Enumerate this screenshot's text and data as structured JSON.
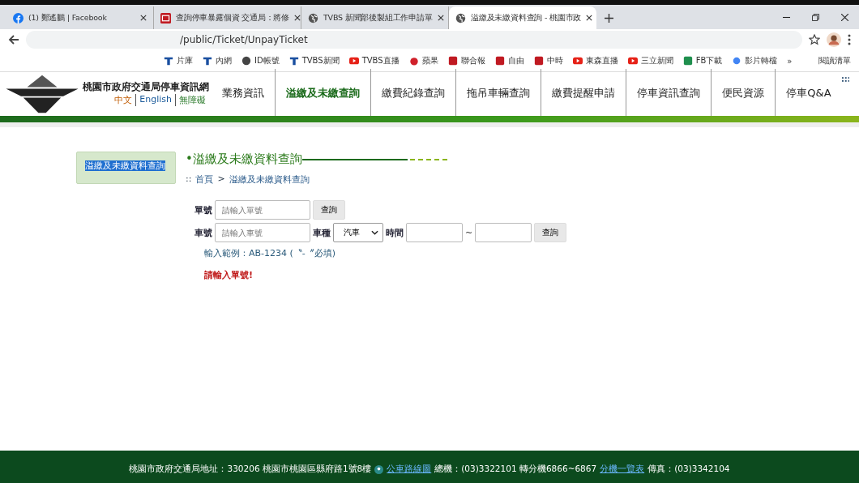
{
  "tabs": [
    {
      "kind": "facebook",
      "title": "(1) 鄭遙鵬 | Facebook",
      "selected": false
    },
    {
      "kind": "news",
      "title": "查詢停車暴露個資 交通局：將修",
      "selected": false
    },
    {
      "kind": "web",
      "title": "TVBS 新聞部後製組工作申請單",
      "selected": false
    },
    {
      "kind": "web",
      "title": "溢繳及未繳資料查詢 - 桃園市政",
      "selected": true
    }
  ],
  "address_bar": {
    "url": "/public/Ticket/UnpayTicket"
  },
  "bookmarks": [
    {
      "kind": "tee",
      "label": "片庫"
    },
    {
      "kind": "tee",
      "label": "內網"
    },
    {
      "kind": "web",
      "label": "ID帳號"
    },
    {
      "kind": "tee",
      "label": "TVBS新聞"
    },
    {
      "kind": "video",
      "label": "TVBS直播"
    },
    {
      "kind": "fruit",
      "label": "蘋果"
    },
    {
      "kind": "square",
      "label": "聯合報"
    },
    {
      "kind": "square",
      "label": "自由"
    },
    {
      "kind": "square",
      "label": "中時"
    },
    {
      "kind": "video",
      "label": "東森直播"
    },
    {
      "kind": "video",
      "label": "三立新聞"
    },
    {
      "kind": "green",
      "label": "FB下載"
    },
    {
      "kind": "dots",
      "label": "影片轉檔"
    }
  ],
  "bookmarks_more": "»",
  "reading_list": "閱讀清單",
  "site": {
    "name": "桃園市政府交通局停車資訊網",
    "languages": [
      "中文",
      "English",
      "無障礙"
    ]
  },
  "nav": [
    {
      "label": "業務資訊",
      "selected": false
    },
    {
      "label": "溢繳及未繳查詢",
      "selected": true
    },
    {
      "label": "繳費紀錄查詢",
      "selected": false
    },
    {
      "label": "拖吊車輛查詢",
      "selected": false
    },
    {
      "label": "繳費提醒申請",
      "selected": false
    },
    {
      "label": "停車資訊查詢",
      "selected": false
    },
    {
      "label": "便民資源",
      "selected": false
    },
    {
      "label": "停車Q&A",
      "selected": false
    }
  ],
  "sidebar": {
    "items": [
      {
        "label": "溢繳及未繳資料查詢",
        "selected": true
      }
    ]
  },
  "page_title": "•溢繳及未繳資料查詢",
  "breadcrumb": {
    "prefix": "::",
    "items": [
      "首頁",
      "溢繳及未繳資料查詢"
    ],
    "separator": ">"
  },
  "form": {
    "bill_label": "單號",
    "bill_placeholder": "請輸入單號",
    "bill_button": "查詢",
    "plate_label": "車號",
    "plate_placeholder": "請輸入車號",
    "type_label": "車種",
    "type_value": "汽車",
    "time_label": "時間",
    "time_separator": "~",
    "plate_button": "查詢",
    "hint": "輸入範例：AB-1234 (〝-〞必填)",
    "error": "請輸入單號!"
  },
  "footer": {
    "address": "桃園市政府交通局地址：330206 桃園市桃園區縣府路1號8樓",
    "map_link": "公車路線圖",
    "phone": "總機：(03)3322101 轉分機6866~6867",
    "ext_link": "分機一覽表",
    "fax": "傳真：(03)3342104"
  }
}
